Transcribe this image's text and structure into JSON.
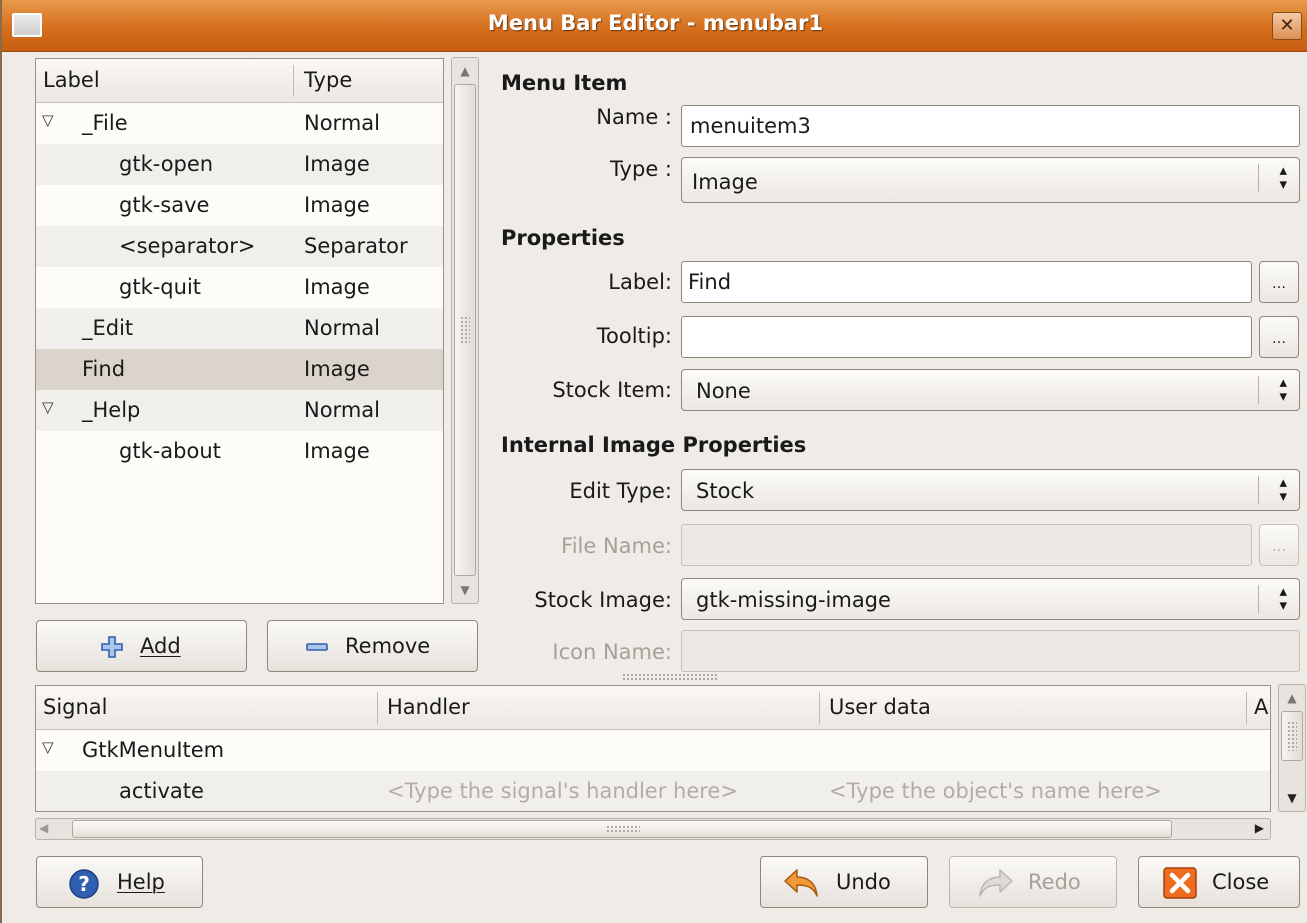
{
  "window": {
    "title": "Menu Bar Editor - menubar1",
    "close_glyph": "✕"
  },
  "tree": {
    "headers": {
      "label": "Label",
      "type": "Type"
    },
    "rows": [
      {
        "label": "_File",
        "type": "Normal",
        "expander": "▽"
      },
      {
        "label": "gtk-open",
        "type": "Image"
      },
      {
        "label": "gtk-save",
        "type": "Image"
      },
      {
        "label": "<separator>",
        "type": "Separator"
      },
      {
        "label": "gtk-quit",
        "type": "Image"
      },
      {
        "label": "_Edit",
        "type": "Normal"
      },
      {
        "label": "Find",
        "type": "Image",
        "selected": true
      },
      {
        "label": "_Help",
        "type": "Normal",
        "expander": "▽"
      },
      {
        "label": "gtk-about",
        "type": "Image"
      }
    ]
  },
  "tree_buttons": {
    "add": "Add",
    "remove": "Remove"
  },
  "form": {
    "menu_item_header": "Menu Item",
    "name_label": "Name :",
    "name_value": "menuitem3",
    "type_label": "Type :",
    "type_value": "Image",
    "properties_header": "Properties",
    "label_label": "Label:",
    "label_value": "Find",
    "tooltip_label": "Tooltip:",
    "tooltip_value": "",
    "stock_item_label": "Stock Item:",
    "stock_item_value": "None",
    "image_header": "Internal Image Properties",
    "edit_type_label": "Edit Type:",
    "edit_type_value": "Stock",
    "file_name_label": "File Name:",
    "stock_image_label": "Stock Image:",
    "stock_image_value": "gtk-missing-image",
    "icon_name_label": "Icon Name:",
    "ellipsis": "…"
  },
  "signals": {
    "headers": {
      "signal": "Signal",
      "handler": "Handler",
      "user_data": "User data",
      "after": "A"
    },
    "group": {
      "name": "GtkMenuItem",
      "expander": "▽"
    },
    "rows": [
      {
        "signal": "activate",
        "handler": "<Type the signal's handler here>",
        "user_data": "<Type the object's name here>"
      }
    ]
  },
  "footer": {
    "help": "Help",
    "undo": "Undo",
    "redo": "Redo",
    "close": "Close"
  },
  "colors": {
    "titlebar": "#d46e1d",
    "selection": "#dbd4ca",
    "help_icon": "#2f5fb0",
    "close_icon": "#e2641a",
    "undo_icon": "#e6821e"
  }
}
